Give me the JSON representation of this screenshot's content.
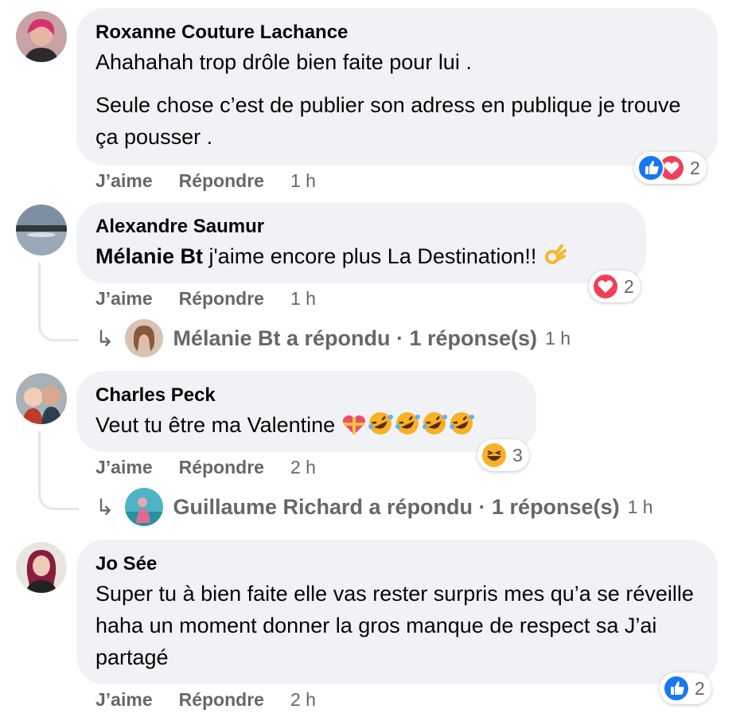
{
  "comments": [
    {
      "author": "Roxanne Couture Lachance",
      "paragraphs": [
        "Ahahahah trop drôle bien faite pour lui .",
        "Seule chose c’est de publier son adress en publique je trouve ça pousser ."
      ],
      "like": "J’aime",
      "reply": "Répondre",
      "time": "1 h",
      "reactions": [
        "like-icon",
        "love-icon"
      ],
      "reaction_count": "2"
    },
    {
      "author": "Alexandre Saumur",
      "mention": "Mélanie Bt",
      "text": " j'aime encore plus La Destination!! ",
      "emoji": "ok-hand-emoji",
      "like": "J’aime",
      "reply": "Répondre",
      "time": "1 h",
      "reactions": [
        "love-icon"
      ],
      "reaction_count": "2",
      "replies": {
        "text": "Mélanie Bt a répondu · 1 réponse(s)",
        "time": "1 h"
      }
    },
    {
      "author": "Charles Peck",
      "text": "Veut tu être ma Valentine ",
      "emojis": [
        "heart-gift-emoji",
        "rofl-emoji",
        "rofl-emoji",
        "rofl-emoji",
        "rofl-emoji"
      ],
      "like": "J’aime",
      "reply": "Répondre",
      "time": "2 h",
      "reactions": [
        "haha-icon"
      ],
      "reaction_count": "3",
      "replies": {
        "text": "Guillaume Richard a répondu · 1 réponse(s)",
        "time": "1 h"
      }
    },
    {
      "author": "Jo Sée",
      "text": "Super tu à bien faite elle vas rester surpris mes qu’a se réveille haha un moment donner la gros manque de respect sa J’ai partagé",
      "like": "J’aime",
      "reply": "Répondre",
      "time": "2 h",
      "reactions": [
        "like-icon"
      ],
      "reaction_count": "2"
    }
  ],
  "colors": {
    "bubble": "#f0f2f5",
    "secondary_text": "#65676b",
    "like_blue": "#1877f2",
    "love_red": "#f33e58",
    "haha_yellow": "#f7b125"
  }
}
